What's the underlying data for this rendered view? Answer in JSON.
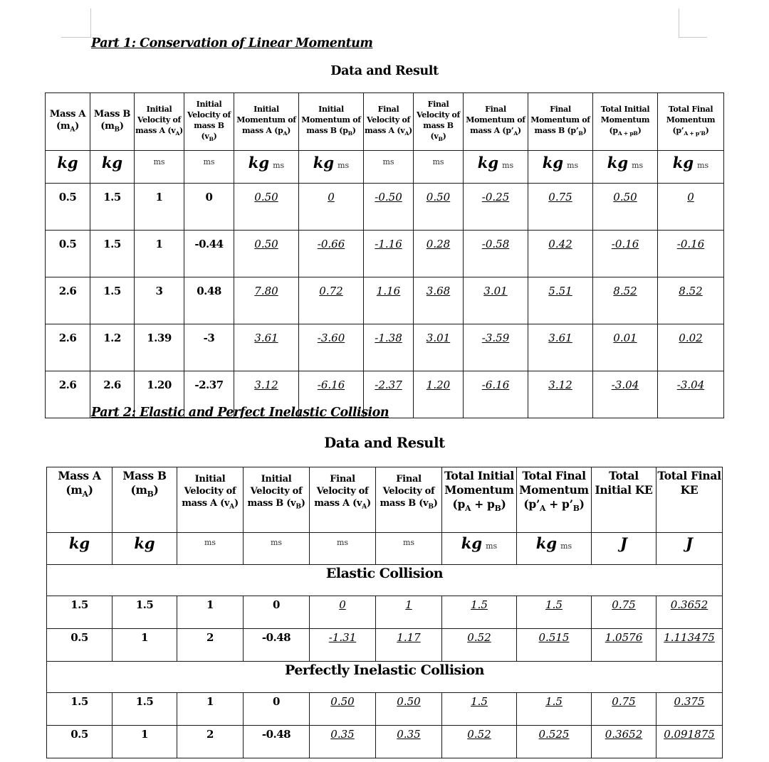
{
  "part1": {
    "heading": "Part 1: Conservation of Linear Momentum",
    "title": "Data and Result",
    "headers": [
      {
        "line1": "Mass A",
        "sym": "(m",
        "sub": "A",
        "close": ")"
      },
      {
        "line1": "Mass B",
        "sym": "(m",
        "sub": "B",
        "close": ")"
      },
      {
        "line1": "Initial Velocity of mass A",
        "sym": "(v",
        "sub": "A",
        "close": ")"
      },
      {
        "line1": "Initial Velocity of mass B",
        "sym": "(v",
        "sub": "B",
        "close": ")"
      },
      {
        "line1": "Initial Momentum of mass A",
        "sym": "(p",
        "sub": "A",
        "close": ")"
      },
      {
        "line1": "Initial Momentum of mass B",
        "sym": "(p",
        "sub": "B",
        "close": ")"
      },
      {
        "line1": "Final Velocity of mass A",
        "sym": "(v",
        "sub": "A",
        "close": ")"
      },
      {
        "line1": "Final Velocity of mass B",
        "sym": "(v",
        "sub": "B",
        "close": ")"
      },
      {
        "line1": "Final Momentum of mass A",
        "sym": "(p’",
        "sub": "A",
        "close": ")"
      },
      {
        "line1": "Final Momentum of mass B",
        "sym": "(p’",
        "sub": "B",
        "close": ")"
      },
      {
        "line1": "Total Initial Momentum",
        "sym": "(p",
        "sub": "A + p",
        "sub2": "B",
        "close": ")"
      },
      {
        "line1": "Total Final Momentum",
        "sym": "(p’",
        "sub": "A + p’",
        "sub2": "B",
        "close": ")"
      }
    ],
    "units": [
      "kg",
      "kg",
      "ms",
      "ms",
      "kg ms",
      "kg ms",
      "ms",
      "ms",
      "kg ms",
      "kg ms",
      "kg ms",
      "kg ms"
    ],
    "rows": [
      [
        "0.5",
        "1.5",
        "1",
        "0",
        "0.50",
        "0",
        "-0.50",
        "0.50",
        "-0.25",
        "0.75",
        "0.50",
        "0"
      ],
      [
        "0.5",
        "1.5",
        "1",
        "-0.44",
        "0.50",
        "-0.66",
        "-1.16",
        "0.28",
        "-0.58",
        "0.42",
        "-0.16",
        "-0.16"
      ],
      [
        "2.6",
        "1.5",
        "3",
        "0.48",
        "7.80",
        "0.72",
        "1.16",
        "3.68",
        "3.01",
        "5.51",
        "8.52",
        "8.52"
      ],
      [
        "2.6",
        "1.2",
        "1.39",
        "-3",
        "3.61",
        "-3.60",
        "-1.38",
        "3.01",
        "-3.59",
        "3.61",
        "0.01",
        "0.02"
      ],
      [
        "2.6",
        "2.6",
        "1.20",
        "-2.37",
        "3.12",
        "-6.16",
        "-2.37",
        "1.20",
        "-6.16",
        "3.12",
        "-3.04",
        "-3.04"
      ]
    ]
  },
  "part2": {
    "heading": "Part 2: Elastic and Perfect Inelastic Collision",
    "title": "Data and Result",
    "headers": [
      {
        "line1": "Mass A",
        "sym": "(m",
        "sub": "A",
        "close": ")"
      },
      {
        "line1": "Mass B",
        "sym": "(m",
        "sub": "B",
        "close": ")"
      },
      {
        "line1": "Initial Velocity of mass A",
        "sym": "(v",
        "sub": "A",
        "close": ")"
      },
      {
        "line1": "Initial Velocity of mass B",
        "sym": "(v",
        "sub": "B",
        "close": ")"
      },
      {
        "line1": "Final Velocity of mass A",
        "sym": "(v",
        "sub": "A",
        "close": ")"
      },
      {
        "line1": "Final Velocity of mass B",
        "sym": "(v",
        "sub": "B",
        "close": ")"
      },
      {
        "line1": "Total Initial Momentum",
        "sym": "(p",
        "sub": "A",
        "mid": " + p",
        "sub2": "B",
        "close": ")"
      },
      {
        "line1": "Total Final Momentum",
        "sym": "(p’",
        "sub": "A",
        "mid": " + p’",
        "sub2": "B",
        "close": ")"
      },
      {
        "line1": "Total Initial KE"
      },
      {
        "line1": "Total Final KE"
      }
    ],
    "units": [
      "kg",
      "kg",
      "ms",
      "ms",
      "ms",
      "ms",
      "kg ms",
      "kg ms",
      "J",
      "J"
    ],
    "groups": [
      {
        "label": "Elastic Collision",
        "rows": [
          [
            "1.5",
            "1.5",
            "1",
            "0",
            "0",
            "1",
            "1.5",
            "1.5",
            "0.75",
            "0.3652"
          ],
          [
            "0.5",
            "1",
            "2",
            "-0.48",
            "-1.31",
            "1.17",
            "0.52",
            "0.515",
            "1.0576",
            "1.113475"
          ]
        ]
      },
      {
        "label": "Perfectly Inelastic Collision",
        "rows": [
          [
            "1.5",
            "1.5",
            "1",
            "0",
            "0.50",
            "0.50",
            "1.5",
            "1.5",
            "0.75",
            "0.375"
          ],
          [
            "0.5",
            "1",
            "2",
            "-0.48",
            "0.35",
            "0.35",
            "0.52",
            "0.525",
            "0.3652",
            "0.091875"
          ]
        ]
      }
    ]
  }
}
